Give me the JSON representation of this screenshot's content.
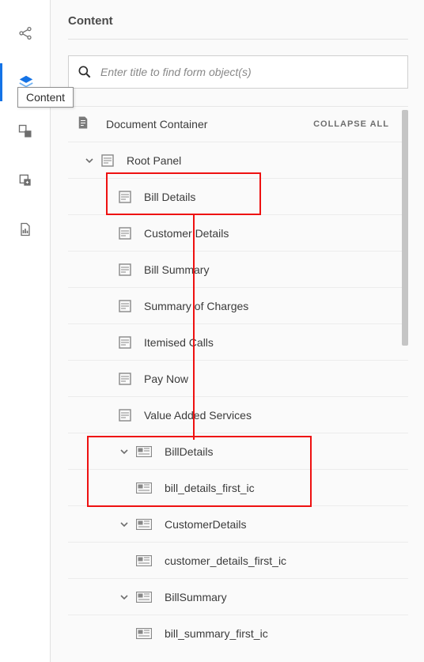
{
  "panel": {
    "title": "Content"
  },
  "tooltip": "Content",
  "search": {
    "placeholder": "Enter title to find form object(s)"
  },
  "collapse_all": "COLLAPSE ALL",
  "doc_container": "Document Container",
  "tree": {
    "root": "Root Panel",
    "bill_details": "Bill Details",
    "customer_details": "Customer Details",
    "bill_summary": "Bill Summary",
    "summary_of_charges": "Summary of Charges",
    "itemised_calls": "Itemised Calls",
    "pay_now": "Pay Now",
    "value_added_services": "Value Added Services",
    "billdetails_g": "BillDetails",
    "bill_details_first_ic": "bill_details_first_ic",
    "customerdetails_g": "CustomerDetails",
    "customer_details_first_ic": "customer_details_first_ic",
    "billsummary_g": "BillSummary",
    "bill_summary_first_ic": "bill_summary_first_ic"
  }
}
